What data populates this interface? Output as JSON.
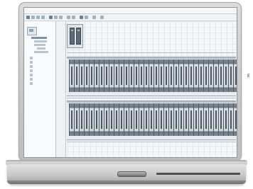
{
  "app": {
    "window_title": "",
    "side_letter": "E",
    "toolbar_tabs": [
      "",
      "",
      "",
      ""
    ],
    "colors": {
      "rack": "#e7ecef",
      "module_dark": "#6a7782",
      "screen_bg": "#eef2f5"
    }
  }
}
